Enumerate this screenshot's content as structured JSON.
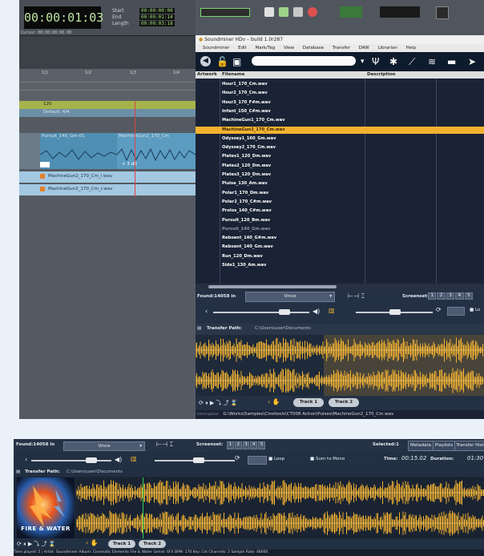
{
  "protools": {
    "counter": "00:00:01:03",
    "counter_labels": [
      "Start",
      "End",
      "Length"
    ],
    "counter_values": [
      "00:00:00:00",
      "00:00:01:14",
      "00:00:03:18"
    ],
    "cursor_line": "Cursor  00:00:00:00.00",
    "ruler_marks": [
      "1|1",
      "1|2",
      "1|3",
      "1|4"
    ],
    "tempo_marker": "120",
    "meter_label": "Default: 4/4",
    "clip_top_left": "Pursuit_140_Gm-01",
    "clip_top_right": "MachineGun2_170_Cm",
    "clip_gain": "+ 3 dB",
    "clip_rows": [
      "MachineGun2_170_Cm_l.wav",
      "MachineGun2_170_Cm_r.wav"
    ]
  },
  "soundminer": {
    "title": "Soundminer HDv – build 1.0r287",
    "menu": [
      "Soundminer",
      "Edit",
      "Mark/Tag",
      "View",
      "Database",
      "Transfer",
      "DAW",
      "Librarian",
      "Help"
    ],
    "columns": [
      "Artwork",
      "Filename",
      "Description"
    ],
    "files": [
      "Hour1_170_Cm.wav",
      "Hour2_170_Cm.wav",
      "Hour3_170_F#m.wav",
      "Infant_150_C#m.wav",
      "MachineGun1_170_Cm.wav",
      "MachineGun2_170_Cm.wav",
      "Odyssey1_160_Gm.wav",
      "Odyssey2_170_Cm.wav",
      "Plates1_120_Dm.wav",
      "Plates2_120_Dm.wav",
      "Plates3_120_Dm.wav",
      "Pluise_130_Am.wav",
      "Polar1_170_Dm.wav",
      "Polar2_170_C#m.wav",
      "Prolos_140_C#m.wav",
      "Pursuit_120_Bm.wav",
      "Pursuit_140_Gm.wav",
      "Reboent_140_G#m.wav",
      "Reboent_140_Gm.wav",
      "Run_120_Dm.wav",
      "Side1_130_Am.wav"
    ],
    "selected_index": 5,
    "dim_index": 16,
    "found_label": "Found:14058 in",
    "user": "Vince",
    "screenset_label": "Screenset:",
    "screenset_slots": [
      "1",
      "2",
      "3",
      "4",
      "5"
    ],
    "path_label": "Transfer Path:",
    "path_value": "C:\\Users\\user\\Documents",
    "track1": "Track 1",
    "track2": "Track 2",
    "status_path": "G:\\Works\\Samples\\Cinetools\\CT008 Action\\Pulses\\MachineGun2_170_Cm.wav",
    "status_prefix": "Interruption",
    "lo_label": "Lo"
  },
  "shot2": {
    "found_label": "Found:14058 in",
    "user": "Vince",
    "screenset_label": "Screenset:",
    "screenset_slots": [
      "1",
      "2",
      "3",
      "4",
      "5"
    ],
    "selected_label": "Selected:1",
    "tabs": [
      "Metadata",
      "Playlists",
      "Transfer Hist"
    ],
    "loop_label": "Loop",
    "sum_label": "Sum to Mono",
    "time_label": "Time:",
    "time_value": "00:15.02",
    "duration_label": "Duration:",
    "duration_value": "01:30",
    "path_label": "Transfer Path:",
    "path_value": "C:\\Users\\user\\Documents",
    "artwork_text": "FIRE & WATER",
    "track1": "Track 1",
    "track2": "Track 2",
    "status": "Time played: 5 | Artist: Soundminer  Album: Cinematic Elements  Fire & Water  Genre: SFX  BPM: 170  Key: Cm  Channels: 2  Sample Rate: 48000"
  },
  "colors": {
    "waveform": "#f2b230",
    "selected_row": "#f2b230",
    "panel": "#1e2a3a"
  }
}
